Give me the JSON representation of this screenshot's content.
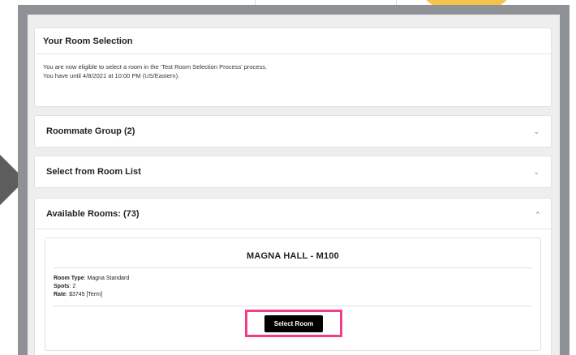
{
  "selection": {
    "title": "Your Room Selection",
    "line1": "You are now eligible to select a room in the 'Test Room Selection Process' process.",
    "line2": "You have until 4/8/2021 at 10:00 PM (US/Eastern)."
  },
  "accordions": [
    {
      "label": "Roommate Group (2)",
      "chevron": "⌄"
    },
    {
      "label": "Select from Room List",
      "chevron": "⌄"
    },
    {
      "label": "Available Rooms: (73)",
      "chevron": "^"
    }
  ],
  "room": {
    "title": "MAGNA HALL - M100",
    "type_label": "Room Type",
    "type_value": ": Magna Standard",
    "spots_label": "Spots",
    "spots_value": ": 2",
    "rate_label": "Rate",
    "rate_value": ": $3745 [Term]",
    "button_label": "Select Room"
  },
  "colors": {
    "frame": "#8e9296",
    "highlight": "#ef3d8a",
    "button": "#000000"
  }
}
